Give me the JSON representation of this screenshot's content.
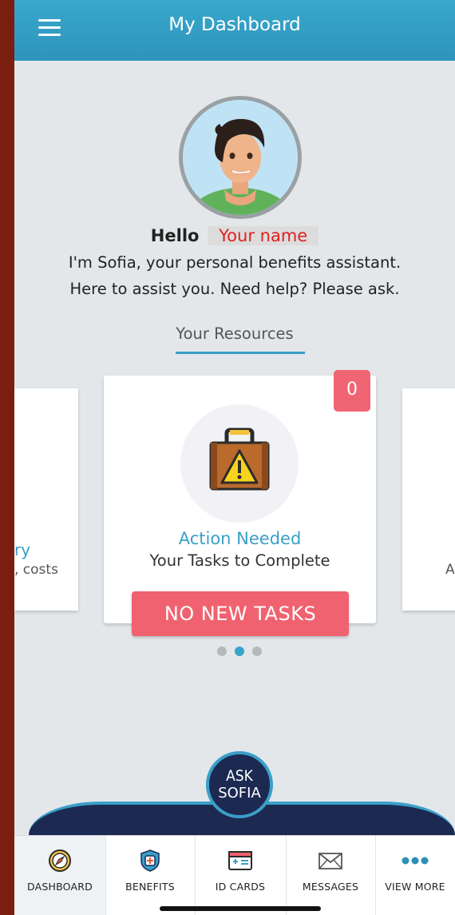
{
  "header": {
    "title": "My Dashboard"
  },
  "greeting": {
    "hello": "Hello",
    "name": "Your name",
    "line1": "I'm Sofia, your personal benefits assistant.",
    "line2": "Here to assist you. Need help? Please ask."
  },
  "resources": {
    "title": "Your Resources",
    "left_card": {
      "title_fragment": "ry",
      "subtitle_fragment": ", costs"
    },
    "right_card": {
      "subtitle_fragment": "A"
    },
    "main_card": {
      "badge_count": "0",
      "title": "Action Needed",
      "subtitle": "Your Tasks to Complete",
      "button_label": "NO NEW  TASKS",
      "icon": "briefcase-warning-icon"
    },
    "pager": {
      "count": 3,
      "active": 2
    }
  },
  "ask": {
    "line1": "ASK",
    "line2": "SOFIA"
  },
  "tabs": [
    {
      "label": "DASHBOARD",
      "icon": "compass-icon"
    },
    {
      "label": "BENEFITS",
      "icon": "shield-plus-icon"
    },
    {
      "label": "ID CARDS",
      "icon": "id-card-icon"
    },
    {
      "label": "MESSAGES",
      "icon": "envelope-icon"
    },
    {
      "label": "VIEW MORE",
      "icon": "ellipsis-icon"
    }
  ],
  "colors": {
    "header": "#2d94bb",
    "accent": "#3a9fc8",
    "alert": "#f0626f",
    "navy": "#1c2a52",
    "background": "#e3e7ea"
  }
}
